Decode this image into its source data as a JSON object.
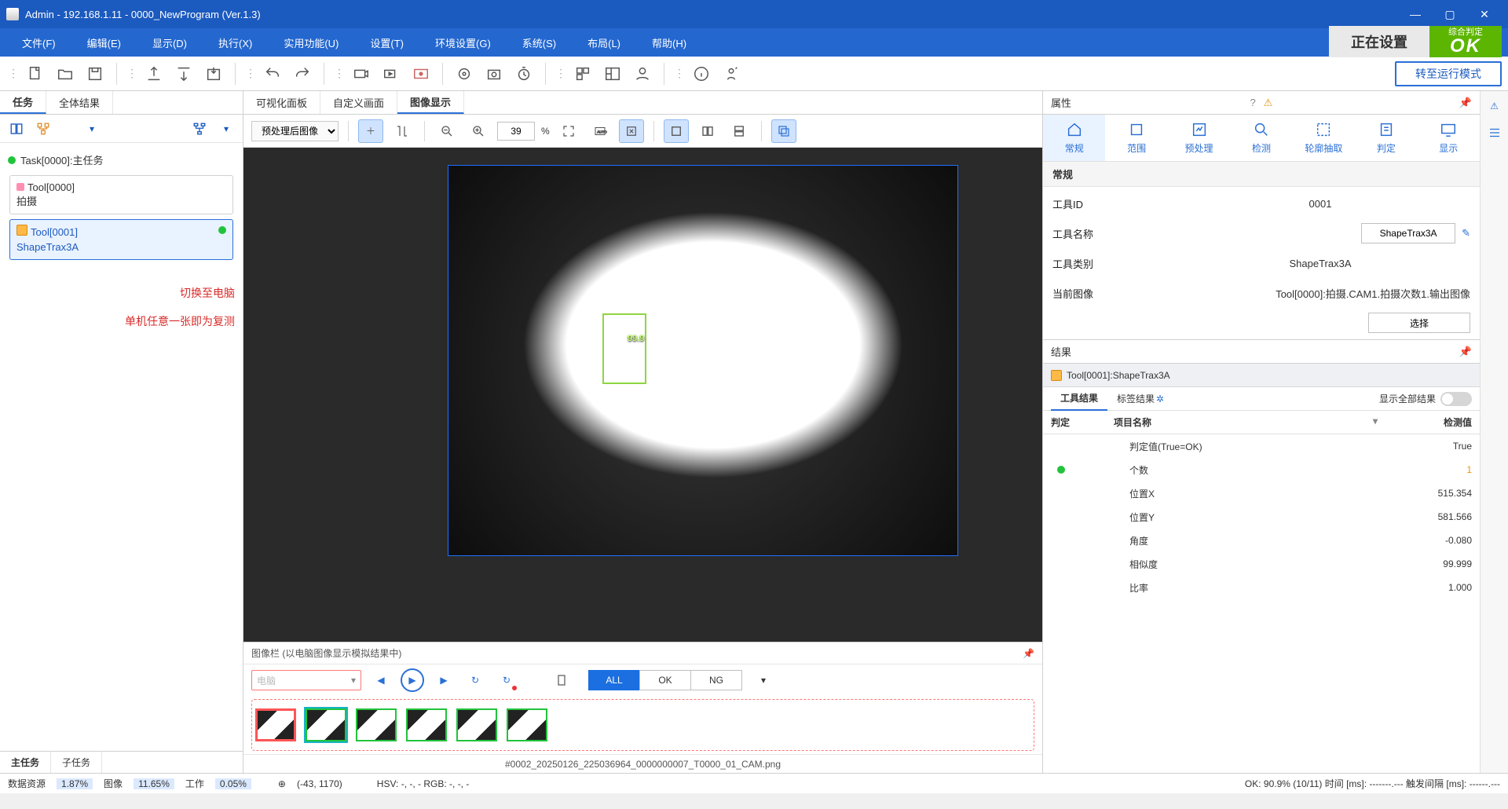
{
  "title": "Admin - 192.168.1.11 - 0000_NewProgram (Ver.1.3)",
  "menubar": [
    "文件(F)",
    "编辑(E)",
    "显示(D)",
    "执行(X)",
    "实用功能(U)",
    "设置(T)",
    "环境设置(G)",
    "系统(S)",
    "布局(L)",
    "帮助(H)"
  ],
  "status_setting": "正在设置",
  "status_ok_small": "综合判定",
  "status_ok_big": "OK",
  "mode_btn": "转至运行模式",
  "left": {
    "tabs": [
      "任务",
      "全体结果"
    ],
    "task": "Task[0000]:主任务",
    "tool0_name": "Tool[0000]",
    "tool0_sub": "拍摄",
    "tool1_name": "Tool[0001]",
    "tool1_sub": "ShapeTrax3A",
    "bottom_tabs": [
      "主任务",
      "子任务"
    ],
    "anno1": "切换至电脑",
    "anno2": "单机任意一张即为复测"
  },
  "center": {
    "tabs": [
      "可视化面板",
      "自定义画面",
      "图像显示"
    ],
    "img_select": "预处理后图像",
    "zoom": "39",
    "zoom_unit": "%",
    "shape_label": "99.9"
  },
  "imagebar": {
    "title": "图像栏  (以电脑图像显示模拟结果中)",
    "src": "电脑",
    "filters": [
      "ALL",
      "OK",
      "NG"
    ],
    "filename": "#0002_20250126_225036964_0000000007_T0000_01_CAM.png"
  },
  "props": {
    "panel": "属性",
    "tabs": [
      "常规",
      "范围",
      "预处理",
      "检测",
      "轮廓抽取",
      "判定",
      "显示"
    ],
    "section": "常规",
    "rows": {
      "id_k": "工具ID",
      "id_v": "0001",
      "name_k": "工具名称",
      "name_v": "ShapeTrax3A",
      "cat_k": "工具类别",
      "cat_v": "ShapeTrax3A",
      "img_k": "当前图像",
      "img_v": "Tool[0000]:拍摄.CAM1.拍摄次数1.输出图像",
      "sel_btn": "选择"
    }
  },
  "results": {
    "panel": "结果",
    "tool": "Tool[0001]:ShapeTrax3A",
    "tabs": [
      "工具结果",
      "标签结果"
    ],
    "show_all": "显示全部结果",
    "cols": [
      "判定",
      "项目名称",
      "检测值"
    ],
    "rows": [
      {
        "name": "判定值(True=OK)",
        "val": "True"
      },
      {
        "name": "个数",
        "val": "1",
        "orange": true,
        "dot": true
      },
      {
        "name": "位置X",
        "val": "515.354"
      },
      {
        "name": "位置Y",
        "val": "581.566"
      },
      {
        "name": "角度",
        "val": "-0.080"
      },
      {
        "name": "相似度",
        "val": "99.999"
      },
      {
        "name": "比率",
        "val": "1.000"
      }
    ]
  },
  "statusbar": {
    "data_k": "数据资源",
    "data_v": "1.87%",
    "img_k": "图像",
    "img_v": "11.65%",
    "work_k": "工作",
    "work_v": "0.05%",
    "coord": "(-43, 1170)",
    "hsv": "HSV: -, -, - RGB: -, -, -",
    "right": "OK: 90.9% (10/11) 时间 [ms]: -------.--- 触发间隔 [ms]: ------.---"
  }
}
